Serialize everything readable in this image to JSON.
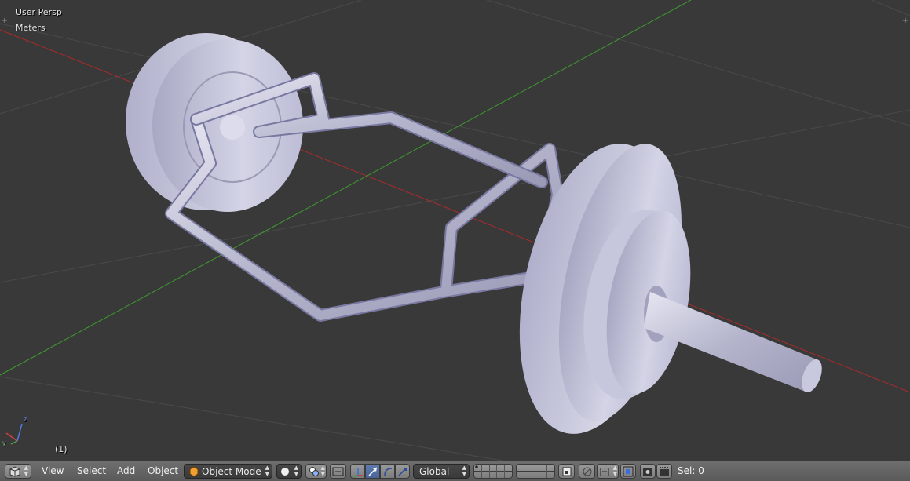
{
  "viewport": {
    "view_name": "User Persp",
    "units": "Meters",
    "frame": "(1)",
    "axes": {
      "z": "z",
      "y": "y"
    }
  },
  "header": {
    "editor_type_icon": "cube-icon",
    "menus": {
      "view": "View",
      "select": "Select",
      "add": "Add",
      "object": "Object"
    },
    "mode": {
      "icon": "object-mode-icon",
      "label": "Object Mode"
    },
    "shading_icon": "solid-sphere-icon",
    "pivot_icon": "pivot-point-icon",
    "manipulator_icons": [
      "manipulator-toggle-icon",
      "translate-icon",
      "rotate-icon",
      "scale-icon"
    ],
    "orientation": "Global",
    "layers_icon": "layer-grid-icon",
    "snap_icons": [
      "lock-layer-icon",
      "proportional-edit-icon",
      "snap-icon",
      "snap-element-icon"
    ],
    "render_icons": [
      "opengl-render-icon",
      "opengl-anim-icon"
    ],
    "selection": "Sel: 0"
  },
  "colors": {
    "viewport_bg": "#393939",
    "grid_line": "#4a4a4a",
    "x_axis": "#b02a2a",
    "y_axis": "#3e9a2f",
    "object": "#c8c8e0",
    "header_bg": "#666666",
    "active_tool": "#5e7bb0"
  }
}
